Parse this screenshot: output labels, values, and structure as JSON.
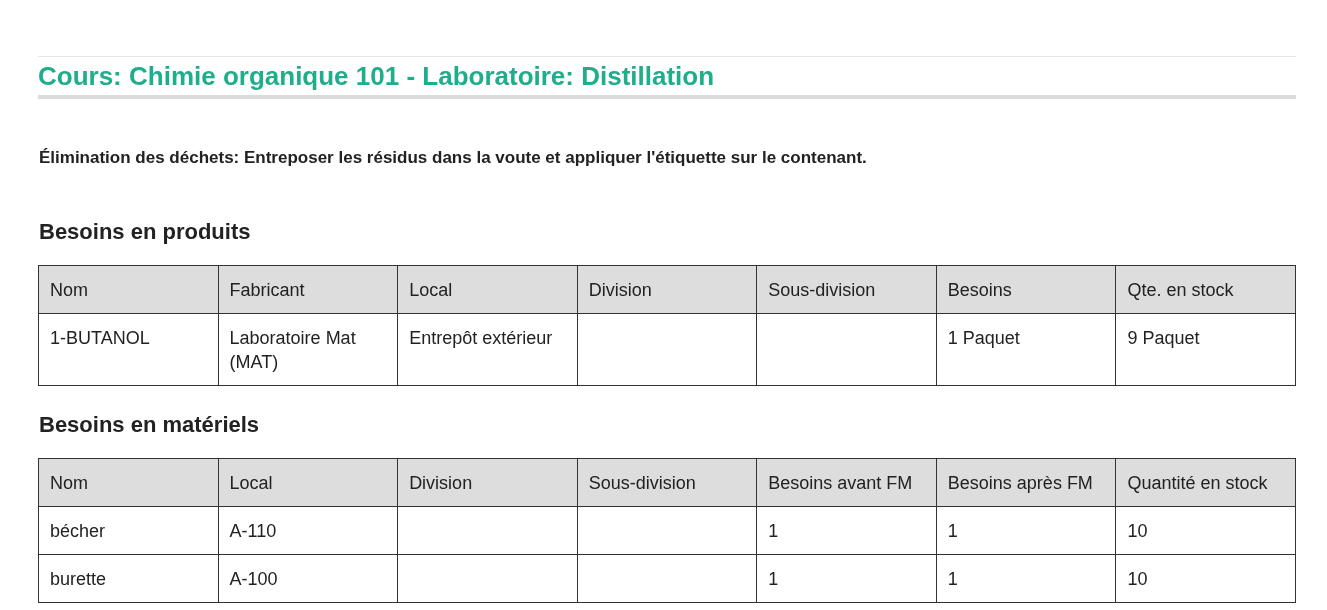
{
  "title": "Cours: Chimie organique 101 - Laboratoire: Distillation",
  "disposal": {
    "label": "Élimination des déchets:",
    "text": "Entreposer les résidus dans la voute et appliquer l'étiquette sur le contenant."
  },
  "sections": [
    {
      "heading": "Besoins en produits",
      "columns": [
        "Nom",
        "Fabricant",
        "Local",
        "Division",
        "Sous-division",
        "Besoins",
        "Qte. en stock"
      ],
      "rows": [
        [
          "1-BUTANOL",
          "Laboratoire Mat (MAT)",
          "Entrepôt extérieur",
          "",
          "",
          "1 Paquet",
          "9 Paquet"
        ]
      ]
    },
    {
      "heading": "Besoins en matériels",
      "columns": [
        "Nom",
        "Local",
        "Division",
        "Sous-division",
        "Besoins avant FM",
        "Besoins après FM",
        "Quantité en stock"
      ],
      "rows": [
        [
          "bécher",
          "A-110",
          "",
          "",
          "1",
          "1",
          "10"
        ],
        [
          "burette",
          "A-100",
          "",
          "",
          "1",
          "1",
          "10"
        ]
      ]
    }
  ]
}
